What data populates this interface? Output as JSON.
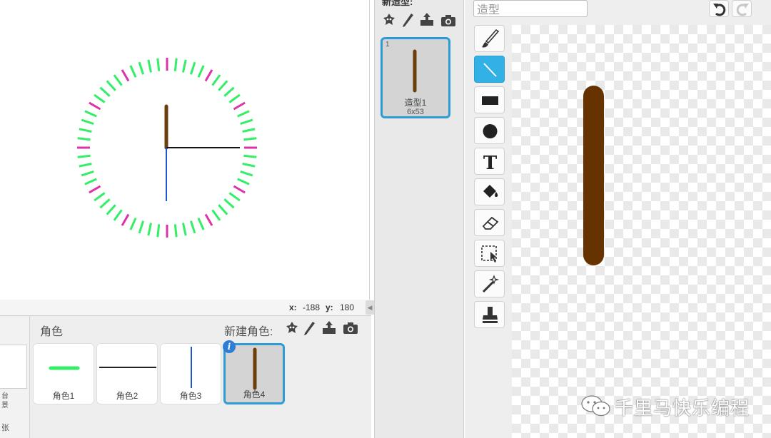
{
  "stage": {
    "coords": {
      "x_label": "x:",
      "x_value": "-188",
      "y_label": "y:",
      "y_value": "180"
    },
    "clock": {
      "minor_tick_color": "#33ee66",
      "major_tick_color": "#dd33aa",
      "hour_hand_color": "#6b3f0c",
      "minute_hand_color": "#111111",
      "second_hand_color": "#1f55cc"
    }
  },
  "sprite_pane": {
    "title": "角色",
    "new_sprite_label": "新建角色:",
    "stage_thumb_label_1": "台\n景",
    "stage_thumb_label_2": "张",
    "sprites": [
      {
        "name": "角色1",
        "selected": false
      },
      {
        "name": "角色2",
        "selected": false
      },
      {
        "name": "角色3",
        "selected": false
      },
      {
        "name": "角色4",
        "selected": true
      }
    ],
    "info_badge": "i"
  },
  "costume_pane": {
    "new_costume_label": "新造型:",
    "costumes": [
      {
        "number": "1",
        "name": "造型1",
        "size": "6x53"
      }
    ]
  },
  "editor": {
    "costume_name": "造型",
    "tools": [
      "brush",
      "line",
      "rectangle",
      "ellipse",
      "text",
      "fill",
      "eraser",
      "select",
      "reshape",
      "stamp"
    ],
    "active_tool": "line",
    "accent_color": "#32b1e6",
    "shape_color": "#663300"
  },
  "watermark": {
    "text": "千里马快乐编程"
  }
}
